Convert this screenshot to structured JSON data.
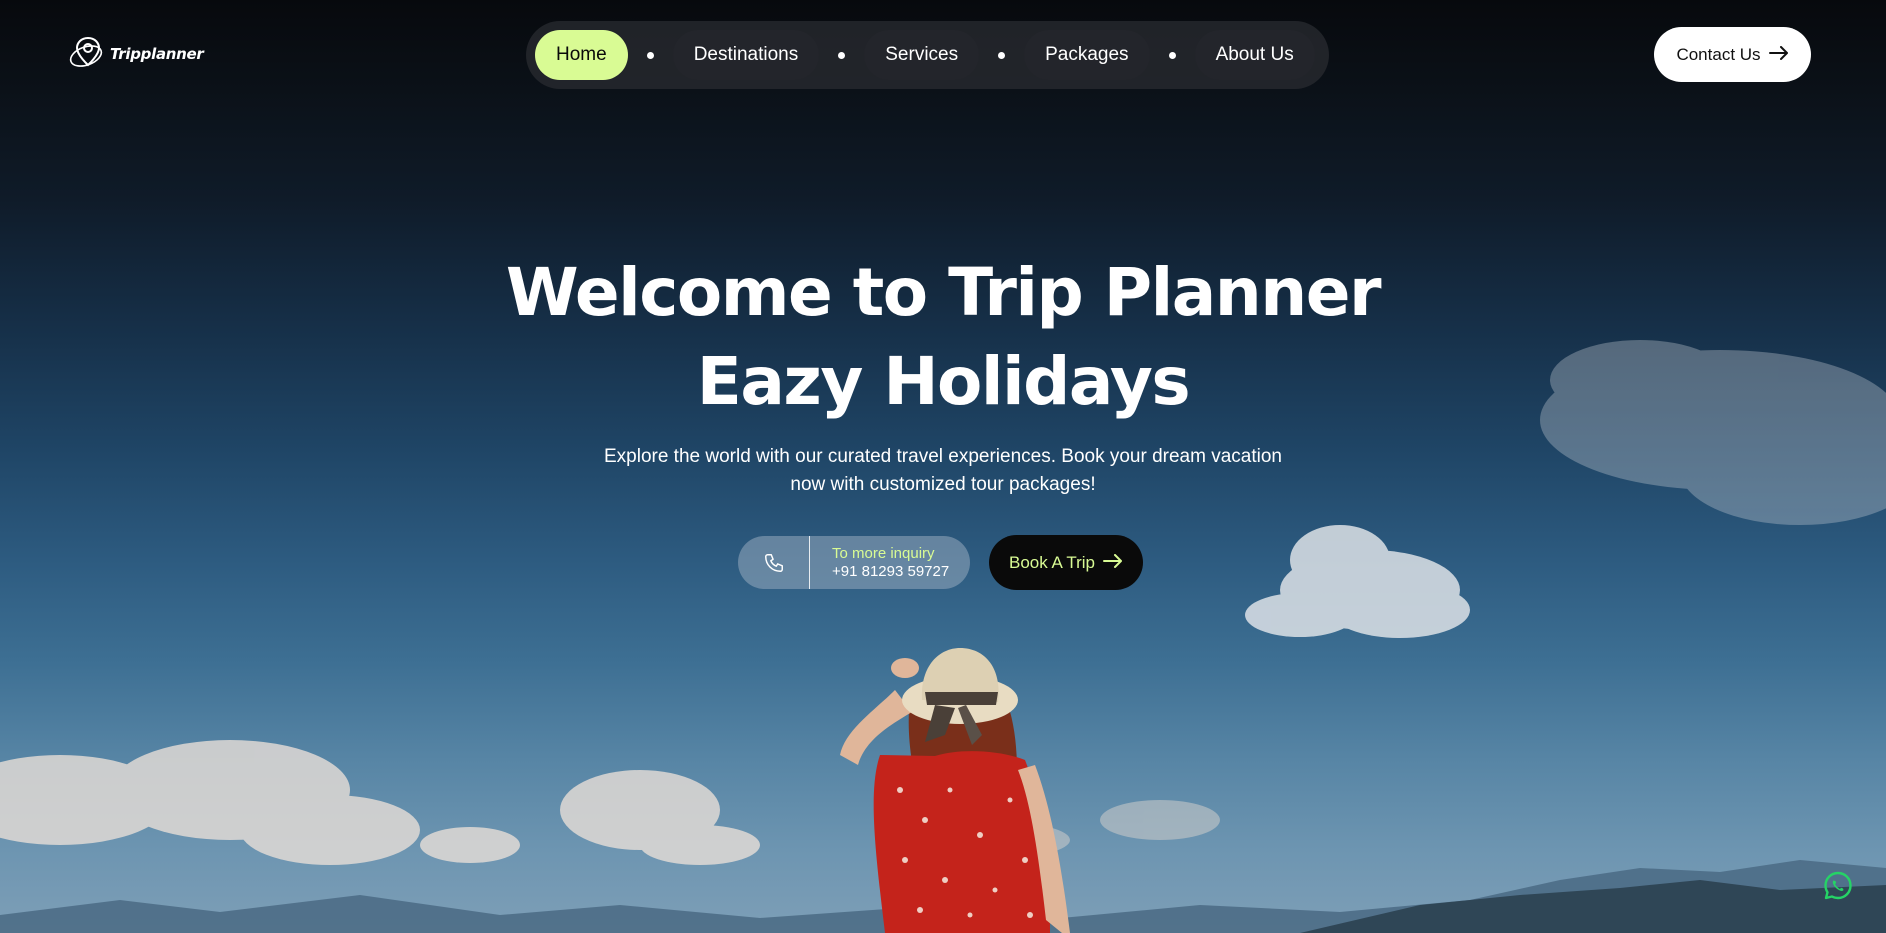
{
  "brand": {
    "name": "Tripplanner"
  },
  "nav": {
    "items": [
      {
        "label": "Home",
        "active": true
      },
      {
        "label": "Destinations",
        "active": false
      },
      {
        "label": "Services",
        "active": false
      },
      {
        "label": "Packages",
        "active": false
      },
      {
        "label": "About Us",
        "active": false
      }
    ]
  },
  "header": {
    "contact_label": "Contact Us",
    "contact_icon": "arrow-right-icon"
  },
  "hero": {
    "title_line1": "Welcome to Trip Planner",
    "title_line2": "Eazy Holidays",
    "subtitle": "Explore the world with our curated travel experiences. Book your dream vacation now with customized tour packages!",
    "inquiry": {
      "icon": "phone-icon",
      "label": "To more inquiry",
      "phone": "+91 81293 59727"
    },
    "book_label": "Book A Trip",
    "book_icon": "arrow-right-icon"
  },
  "floating": {
    "whatsapp_icon": "whatsapp-icon"
  },
  "colors": {
    "accent": "#d9fb94",
    "nav_bg": "#23252b",
    "button_dark": "#0a0a0a",
    "whatsapp": "#25d366"
  }
}
